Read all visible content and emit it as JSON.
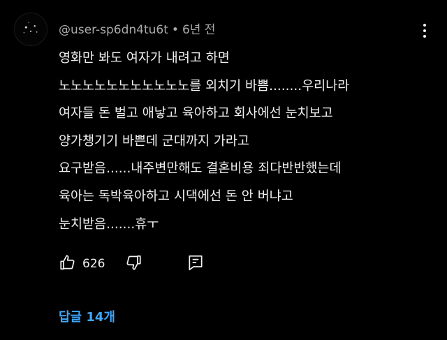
{
  "comment": {
    "author": "@user-sp6dn4tu6t",
    "separator": "•",
    "time": "6년 전",
    "lines": [
      "영화만 봐도 여자가 내려고 하면",
      "노노노노노노노노노노노를 외치기 바쁨........우리나라",
      "여자들 돈 벌고 애낳고 육아하고 회사에선 눈치보고",
      "양가챙기기 바쁜데 군대까지 가라고",
      "요구받음......내주변만해도 결혼비용 죄다반반했는데",
      "육아는 독박육아하고 시댁에선 돈 안 버냐고",
      "눈치받음.......휴ㅜ"
    ],
    "like_count": "626",
    "replies_label": "답글 14개"
  },
  "icons": {
    "avatar": "avatar-image",
    "more": "more-vertical-icon",
    "like": "thumbs-up-icon",
    "dislike": "thumbs-down-icon",
    "reply": "reply-comment-icon"
  },
  "colors": {
    "background": "#000000",
    "text": "#f1f1f1",
    "meta": "#aaaaaa",
    "link": "#3ea6ff"
  }
}
